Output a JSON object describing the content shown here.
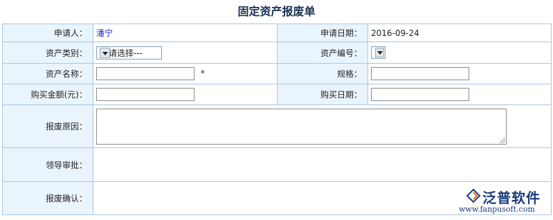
{
  "title": "固定资产报废单",
  "form": {
    "applicant_label": "申请人：",
    "applicant_value": "潘宁",
    "apply_date_label": "申请日期：",
    "apply_date_value": "2016-09-24",
    "category_label": "资产类别：",
    "category_selected": "---请选择---",
    "asset_no_label": "资产编号：",
    "asset_name_label": "资产名称：",
    "asset_name_value": "",
    "required_mark": "*",
    "spec_label": "规格：",
    "spec_value": "",
    "amount_label": "购买金额(元)：",
    "amount_value": "",
    "purchase_date_label": "购买日期：",
    "purchase_date_value": "",
    "reason_label": "报废原因：",
    "reason_value": "",
    "approval_label": "领导审批：",
    "confirm_label": "报废确认："
  },
  "watermark": {
    "brand": "泛普软件",
    "url": "www.fanpusoft.com"
  },
  "colors": {
    "label_bg": "#eaf4fc",
    "border": "#a9c5df",
    "title": "#1a3050",
    "applicant": "#1b2fd0",
    "brand": "#1c3c78"
  }
}
